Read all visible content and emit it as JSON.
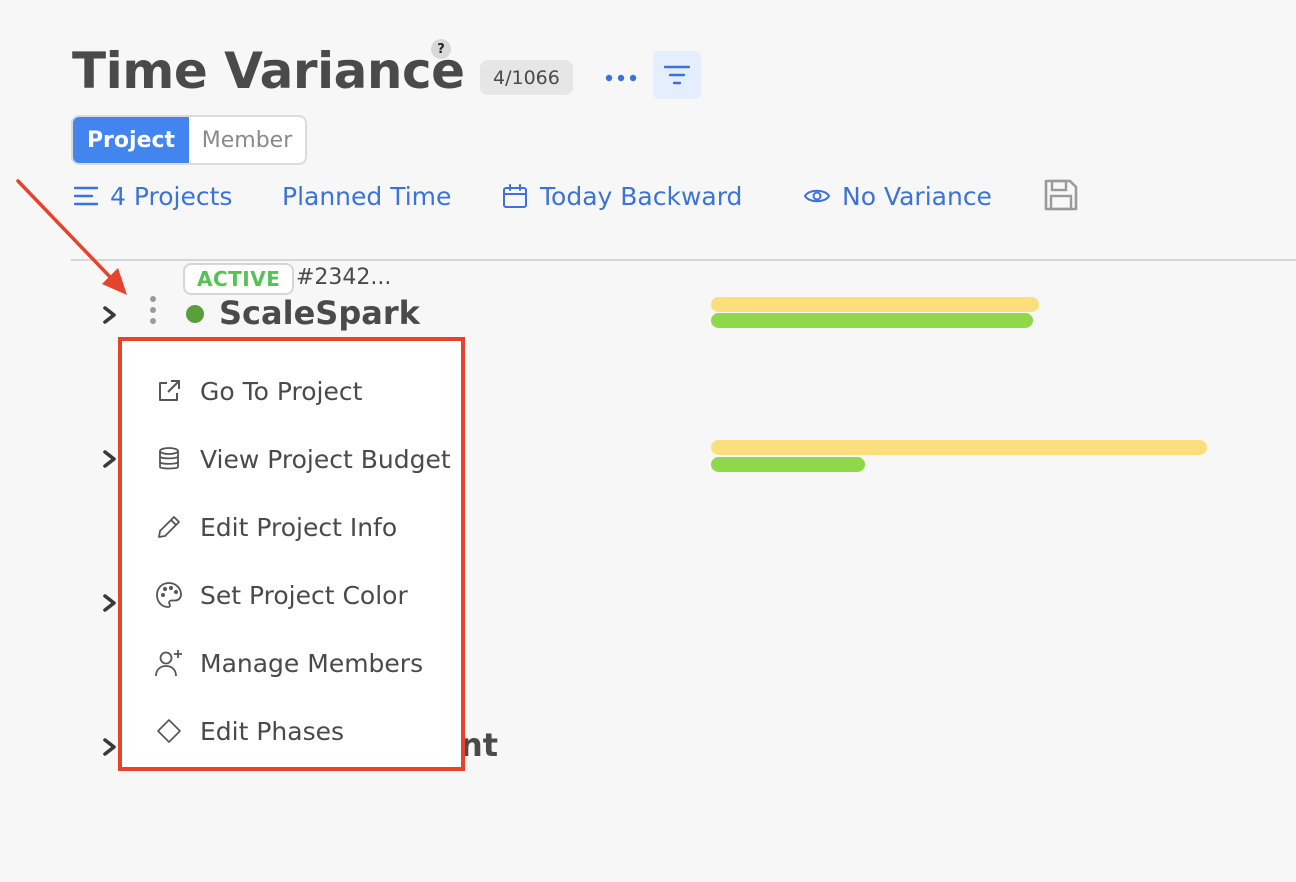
{
  "header": {
    "title": "Time Variance",
    "help_glyph": "?",
    "count": "4/1066"
  },
  "view_toggle": {
    "options": [
      "Project",
      "Member"
    ],
    "selected": "Project"
  },
  "filters": {
    "projects": "4 Projects",
    "time_type": "Planned Time",
    "date_range": "Today Backward",
    "variance": "No Variance"
  },
  "project_row": {
    "status": "ACTIVE",
    "code": "#2342...",
    "name": "ScaleSpark",
    "color": "#5a9e3a"
  },
  "partial_row": {
    "name_fragment": "nt"
  },
  "context_menu": {
    "items": [
      {
        "label": "Go To Project",
        "icon": "external-link-icon"
      },
      {
        "label": "View Project Budget",
        "icon": "database-icon"
      },
      {
        "label": "Edit Project Info",
        "icon": "pencil-icon"
      },
      {
        "label": "Set Project Color",
        "icon": "palette-icon"
      },
      {
        "label": "Manage Members",
        "icon": "add-person-icon"
      },
      {
        "label": "Edit Phases",
        "icon": "diamond-icon"
      }
    ]
  },
  "colors": {
    "accent": "#3b73d9",
    "toggle_active": "#4285ee",
    "status_active": "#56c256",
    "planned_bar": "#fcdf7c",
    "actual_bar": "#8ed84a",
    "highlight": "#e5432b"
  }
}
